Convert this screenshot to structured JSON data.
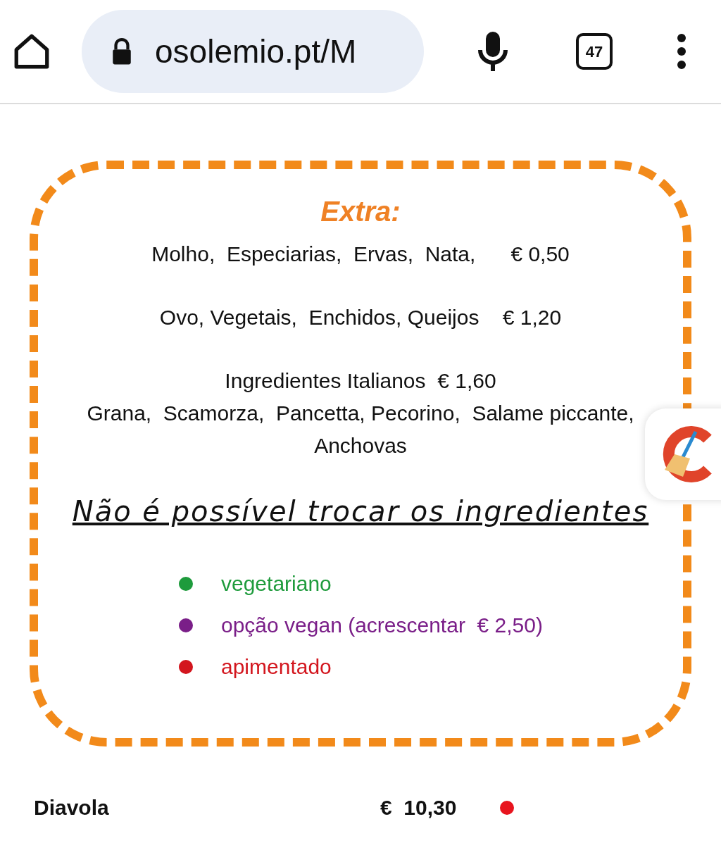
{
  "browser": {
    "url": "osolemio.pt/M",
    "tab_count": "47"
  },
  "extras": {
    "title": "Extra:",
    "groups": [
      [
        "Molho,  Especiarias,  Ervas,  Nata,      € 0,50"
      ],
      [
        "Ovo, Vegetais,  Enchidos, Queijos    € 1,20"
      ],
      [
        "Ingredientes Italianos  € 1,60",
        "Grana,  Scamorza,  Pancetta, Pecorino,  Salame piccante,",
        "Anchovas"
      ]
    ]
  },
  "notice": "Não é possível trocar os ingredientes",
  "legend": [
    {
      "label": "vegetariano",
      "color": "#1e9b3c"
    },
    {
      "label": "opção vegan (acrescentar  € 2,50)",
      "color": "#7a1e88"
    },
    {
      "label": "apimentado",
      "color": "#d3161e"
    }
  ],
  "menu_items": [
    {
      "name": "Diavola",
      "price": "€  10,30",
      "color": "#e8141e"
    }
  ]
}
